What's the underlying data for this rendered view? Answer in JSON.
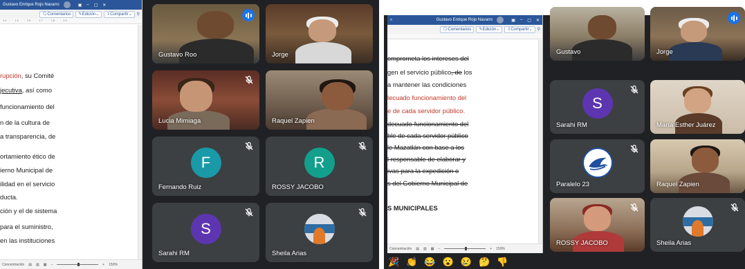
{
  "left": {
    "doc": {
      "title_user": "Gustavo Enrique Rojo Navarro",
      "buttons": {
        "comments": "Comentarios",
        "edit": "Edición",
        "share": "Compartir"
      },
      "ruler": "14 · · 15 · · 16 · · 17 · · 18 · · 19",
      "lines": [
        {
          "parts": [
            {
              "t": "rupción",
              "c": "red"
            },
            {
              "t": ", su Comité",
              "c": ""
            }
          ]
        },
        {
          "parts": [
            {
              "t": "jecutiva",
              "c": "u"
            },
            {
              "t": ",  así  como",
              "c": ""
            }
          ]
        },
        {
          "parts": [
            {
              "t": "funcionamiento del",
              "c": ""
            }
          ]
        },
        {
          "parts": [
            {
              "t": "n  de  la  cultura  de",
              "c": ""
            }
          ]
        },
        {
          "parts": [
            {
              "t": "a transparencia, de",
              "c": ""
            }
          ]
        },
        {
          "parts": [
            {
              "t": "ortamiento ético de",
              "c": ""
            }
          ]
        },
        {
          "parts": [
            {
              "t": "ierno Municipal de",
              "c": ""
            }
          ]
        },
        {
          "parts": [
            {
              "t": "ilidad en el servicio",
              "c": ""
            }
          ]
        },
        {
          "parts": [
            {
              "t": "ducta.",
              "c": ""
            }
          ]
        },
        {
          "parts": [
            {
              "t": "ción y el de sistema",
              "c": ""
            }
          ]
        },
        {
          "parts": [
            {
              "t": "para  el  suministro,",
              "c": ""
            }
          ]
        },
        {
          "parts": [
            {
              "t": "en las instituciones",
              "c": ""
            }
          ]
        }
      ],
      "status": {
        "focus": "Concentración",
        "zoom": "150%"
      }
    },
    "tiles": [
      {
        "name": "Gustavo Roo",
        "kind": "video",
        "scene": "gustavo",
        "active": true,
        "speaking": true
      },
      {
        "name": "Jorge",
        "kind": "video",
        "scene": "jorge",
        "muted": false
      },
      {
        "name": "Lucia Mimiaga",
        "kind": "video",
        "scene": "lucia",
        "muted": true
      },
      {
        "name": "Raquel Zapien",
        "kind": "video",
        "scene": "raquel",
        "muted": false
      },
      {
        "name": "Fernando Ruiz",
        "kind": "avatar",
        "initial": "F",
        "color": "#1a9aa8",
        "muted": true
      },
      {
        "name": "ROSSY JACOBO",
        "kind": "avatar",
        "initial": "R",
        "color": "#12a08d",
        "muted": true
      },
      {
        "name": "Sarahi RM",
        "kind": "avatar",
        "initial": "S",
        "color": "#5e35b1",
        "muted": true
      },
      {
        "name": "Sheila Arias",
        "kind": "logo",
        "muted": true
      }
    ]
  },
  "right": {
    "doc": {
      "title_user": "Gustavo Enrique Rojo Navarro",
      "buttons": {
        "comments": "Comentarios",
        "edit": "Edición",
        "share": "Compartir"
      },
      "lines": [
        {
          "parts": [
            {
              "t": "omprometa los intereses del",
              "c": "strike"
            }
          ]
        },
        {
          "parts": [
            {
              "t": "gen el servicio público",
              "c": ""
            },
            {
              "t": ", de",
              "c": "strike"
            },
            {
              "t": " los",
              "c": ""
            }
          ]
        },
        {
          "parts": [
            {
              "t": "a  mantener  las  condiciones",
              "c": ""
            }
          ]
        },
        {
          "parts": [
            {
              "t": "lecuado funcionamiento del",
              "c": "red"
            }
          ]
        },
        {
          "parts": [
            {
              "t": "e  de  cada  servidor  público.",
              "c": "red"
            }
          ]
        },
        {
          "parts": [
            {
              "t": "decuado funcionamiento del",
              "c": "strike"
            }
          ]
        },
        {
          "parts": [
            {
              "t": "ble de cada servidor público",
              "c": "strike"
            }
          ]
        },
        {
          "parts": [
            {
              "t": "le  Mazatlán  con  base  a  los",
              "c": "strike"
            }
          ]
        },
        {
          "parts": [
            {
              "t": "l  responsable  de  elaborar  y",
              "c": "strike"
            }
          ]
        },
        {
          "parts": [
            {
              "t": "ivas  para  la  expedición  o",
              "c": "strike"
            }
          ]
        },
        {
          "parts": [
            {
              "t": "s del  Gobierno  Municipal  de",
              "c": "strike"
            }
          ]
        },
        {
          "parts": [
            {
              "t": "S MUNICIPALES",
              "c": "bold"
            }
          ]
        }
      ],
      "status": {
        "focus": "Concentración",
        "zoom": "150%"
      }
    },
    "tiles": [
      {
        "name": "Gustavo",
        "kind": "video",
        "scene": "gustavo2",
        "muted": false
      },
      {
        "name": "Jorge",
        "kind": "video",
        "scene": "jorge2",
        "active": true,
        "speaking": true
      },
      {
        "name": "Sarahi RM",
        "kind": "avatar",
        "initial": "S",
        "color": "#5e35b1",
        "muted": true
      },
      {
        "name": "María Esther Juárez",
        "kind": "video",
        "scene": "maria",
        "muted": false
      },
      {
        "name": "Paralelo 23",
        "kind": "emblem",
        "muted": true
      },
      {
        "name": "Raquel Zapien",
        "kind": "video",
        "scene": "raquel2",
        "muted": false
      },
      {
        "name": "ROSSY JACOBO",
        "kind": "video",
        "scene": "rossy",
        "muted": true
      },
      {
        "name": "Sheila Arias",
        "kind": "logo",
        "muted": true
      }
    ],
    "emojis": [
      "🎉",
      "👏",
      "😂",
      "😮",
      "😢",
      "🤔",
      "👎"
    ]
  }
}
